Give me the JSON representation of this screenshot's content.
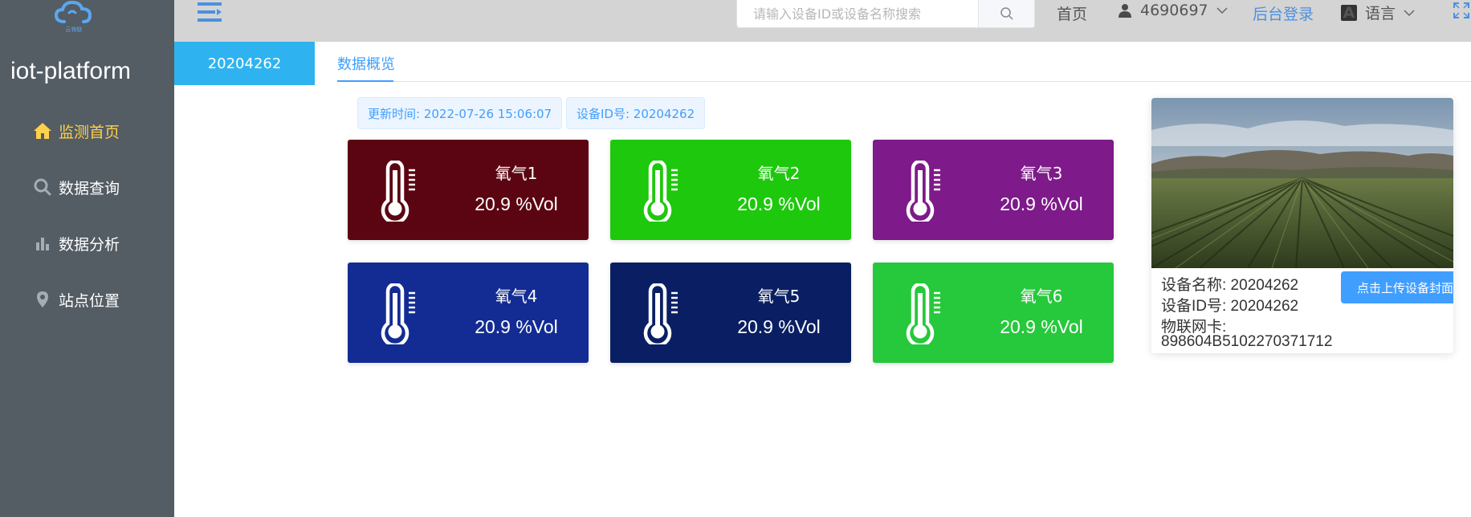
{
  "sidebar": {
    "logo_text": "云物联",
    "brand": "iot-platform",
    "items": [
      {
        "label": "监测首页",
        "icon": "home-icon",
        "active": true
      },
      {
        "label": "数据查询",
        "icon": "search-icon",
        "active": false
      },
      {
        "label": "数据分析",
        "icon": "bar-chart-icon",
        "active": false
      },
      {
        "label": "站点位置",
        "icon": "location-pin-icon",
        "active": false
      }
    ]
  },
  "header": {
    "search_placeholder": "请输入设备ID或设备名称搜索",
    "home_label": "首页",
    "username": "4690697",
    "admin_login": "后台登录",
    "lang_badge": "A",
    "language_label": "语言"
  },
  "tabs": {
    "device_tab": "20204262",
    "overview_tab": "数据概览"
  },
  "info": {
    "update_time": "更新时间: 2022-07-26 15:06:07",
    "device_id": "设备ID号: 20204262"
  },
  "sensors": [
    {
      "title": "氧气1",
      "value": "20.9 %Vol",
      "color": "#5c0512"
    },
    {
      "title": "氧气2",
      "value": "20.9 %Vol",
      "color": "#1ec80d"
    },
    {
      "title": "氧气3",
      "value": "20.9 %Vol",
      "color": "#7e1a8a"
    },
    {
      "title": "氧气4",
      "value": "20.9 %Vol",
      "color": "#132c93"
    },
    {
      "title": "氧气5",
      "value": "20.9 %Vol",
      "color": "#0a1f63"
    },
    {
      "title": "氧气6",
      "value": "20.9 %Vol",
      "color": "#26c93b"
    }
  ],
  "device": {
    "name_line": "设备名称: 20204262",
    "id_line": "设备ID号: 20204262",
    "sim_label": "物联网卡:",
    "sim_value": "898604B5102270371712",
    "upload_button": "点击上传设备封面"
  },
  "colors": {
    "sidebar_bg": "#545c64",
    "active_menu": "#ffd04b",
    "accent": "#409eff",
    "tab_active_bg": "#2fb3f0"
  }
}
